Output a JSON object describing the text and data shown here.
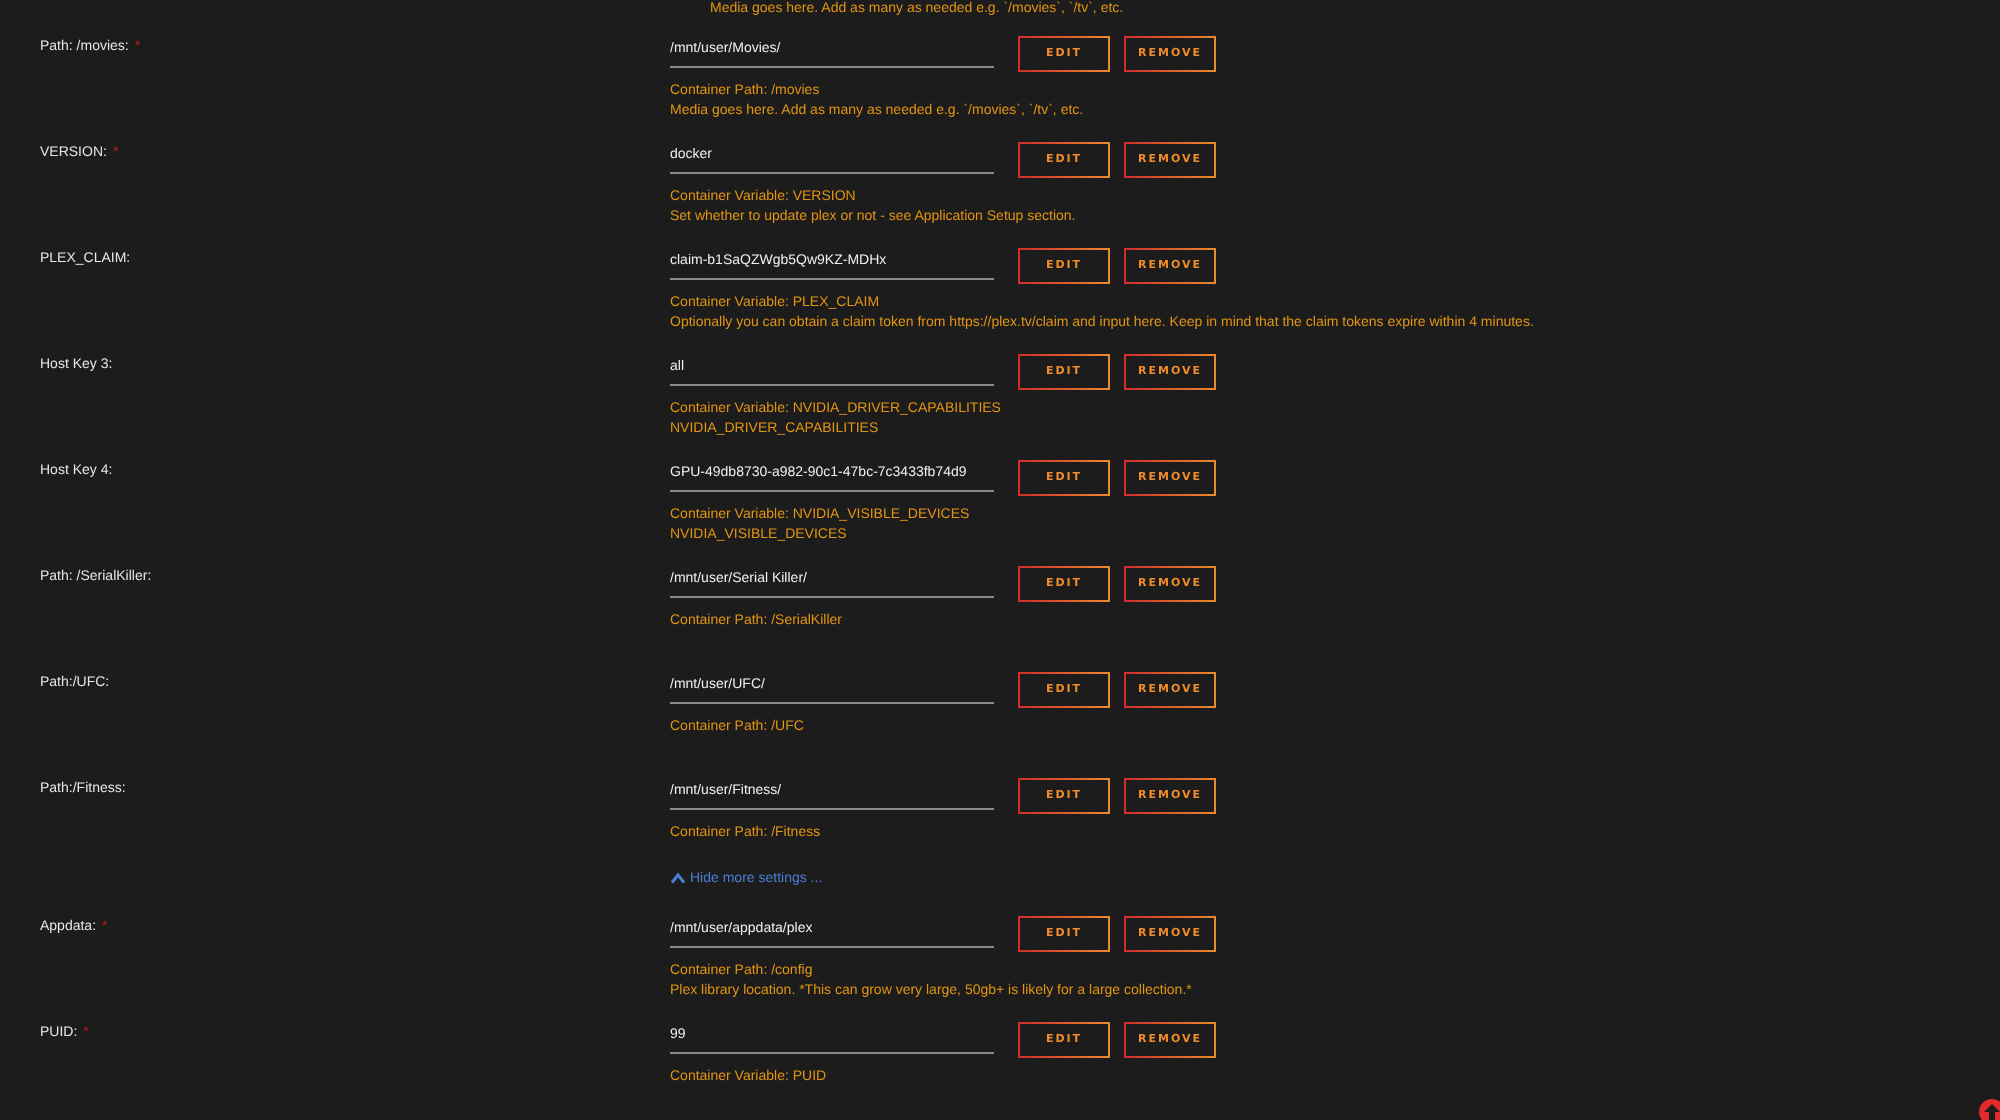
{
  "required_mark": "*",
  "top_note": "Media goes here. Add as many as needed e.g. `/movies`, `/tv`, etc.",
  "rows": [
    {
      "kind": "field",
      "label": "Path: /movies:",
      "required": true,
      "value": "/mnt/user/Movies/",
      "buttons": [
        "EDIT",
        "REMOVE"
      ],
      "notes": [
        "Container Path: /movies",
        "Media goes here. Add as many as needed e.g. `/movies`, `/tv`, etc."
      ]
    },
    {
      "kind": "field",
      "label": "VERSION:",
      "required": true,
      "value": "docker",
      "buttons": [
        "EDIT",
        "REMOVE"
      ],
      "notes": [
        "Container Variable: VERSION",
        "Set whether to update plex or not - see Application Setup section."
      ]
    },
    {
      "kind": "field",
      "label": "PLEX_CLAIM:",
      "required": false,
      "value": "claim-b1SaQZWgb5Qw9KZ-MDHx",
      "buttons": [
        "EDIT",
        "REMOVE"
      ],
      "notes": [
        "Container Variable: PLEX_CLAIM",
        "Optionally you can obtain a claim token from https://plex.tv/claim and input here. Keep in mind that the claim tokens expire within 4 minutes."
      ]
    },
    {
      "kind": "field",
      "label": "Host Key 3:",
      "required": false,
      "value": "all",
      "buttons": [
        "EDIT",
        "REMOVE"
      ],
      "notes": [
        "Container Variable: NVIDIA_DRIVER_CAPABILITIES",
        "NVIDIA_DRIVER_CAPABILITIES"
      ]
    },
    {
      "kind": "field",
      "label": "Host Key 4:",
      "required": false,
      "value": "GPU-49db8730-a982-90c1-47bc-7c3433fb74d9",
      "buttons": [
        "EDIT",
        "REMOVE"
      ],
      "notes": [
        "Container Variable: NVIDIA_VISIBLE_DEVICES",
        "NVIDIA_VISIBLE_DEVICES"
      ]
    },
    {
      "kind": "field",
      "label": "Path: /SerialKiller:",
      "required": false,
      "value": "/mnt/user/Serial Killer/",
      "buttons": [
        "EDIT",
        "REMOVE"
      ],
      "notes": [
        "Container Path: /SerialKiller"
      ]
    },
    {
      "kind": "field",
      "label": "Path:/UFC:",
      "required": false,
      "value": "/mnt/user/UFC/",
      "buttons": [
        "EDIT",
        "REMOVE"
      ],
      "notes": [
        "Container Path: /UFC"
      ]
    },
    {
      "kind": "field",
      "label": "Path:/Fitness:",
      "required": false,
      "value": "/mnt/user/Fitness/",
      "buttons": [
        "EDIT",
        "REMOVE"
      ],
      "notes": [
        "Container Path: /Fitness"
      ]
    },
    {
      "kind": "toggle",
      "label": "Hide more settings ..."
    },
    {
      "kind": "field",
      "label": "Appdata:",
      "required": true,
      "value": "/mnt/user/appdata/plex",
      "buttons": [
        "EDIT",
        "REMOVE"
      ],
      "notes": [
        "Container Path: /config",
        "Plex library location. *This can grow very large, 50gb+ is likely for a large collection.*"
      ]
    },
    {
      "kind": "field",
      "label": "PUID:",
      "required": true,
      "value": "99",
      "buttons": [
        "EDIT",
        "REMOVE"
      ],
      "notes": [
        "Container Variable: PUID"
      ]
    }
  ]
}
